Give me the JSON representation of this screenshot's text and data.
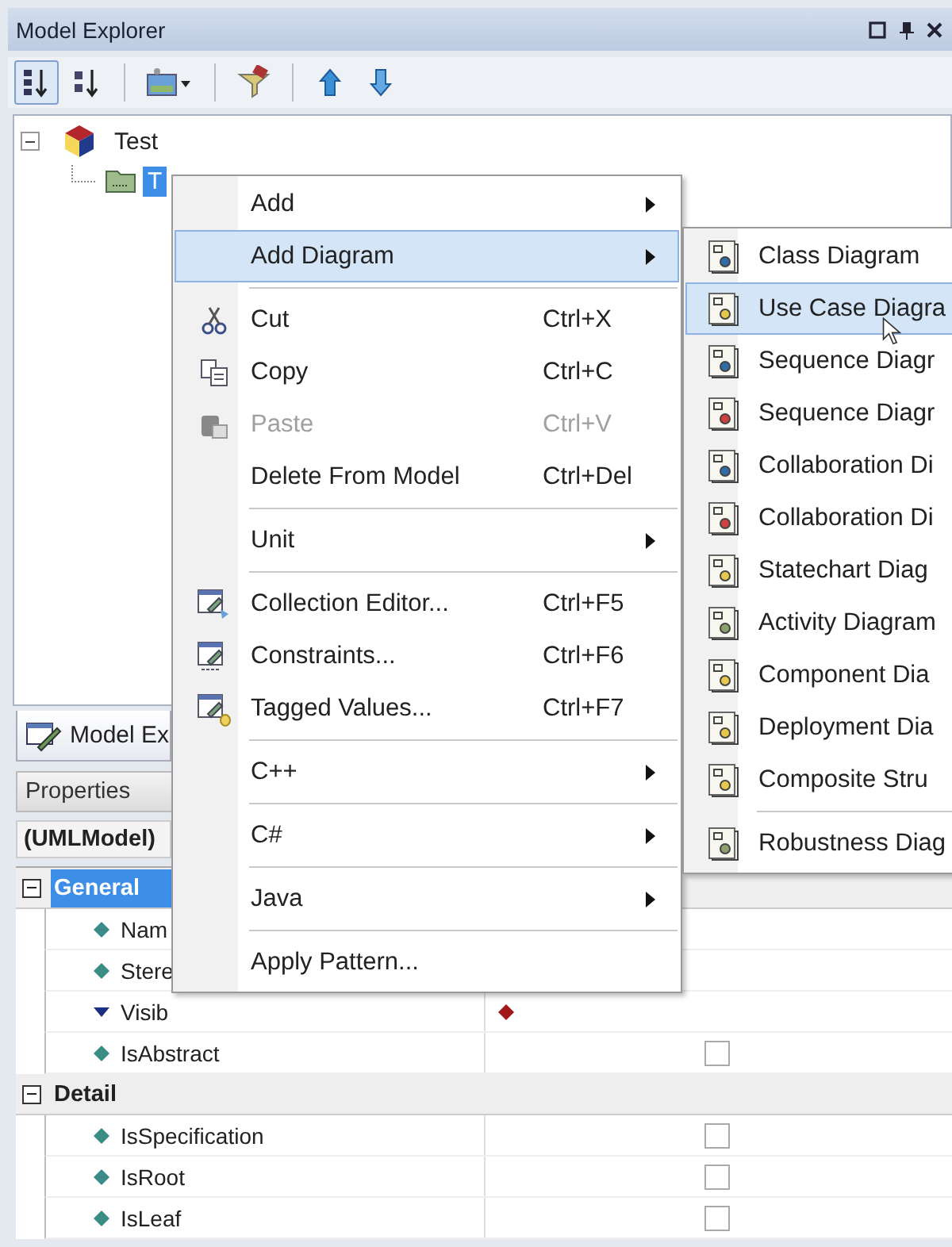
{
  "window": {
    "title": "Model Explorer"
  },
  "toolbar": [
    {
      "kind": "sort-numeric",
      "selected": true
    },
    {
      "kind": "sort-alpha",
      "selected": false
    },
    {
      "kind": "separator"
    },
    {
      "kind": "image-dropdown",
      "selected": false
    },
    {
      "kind": "separator"
    },
    {
      "kind": "filter",
      "selected": false
    },
    {
      "kind": "separator"
    },
    {
      "kind": "move-up",
      "selected": false
    },
    {
      "kind": "move-down",
      "selected": false
    }
  ],
  "tree": [
    {
      "label": "Test",
      "expanded": true,
      "selected": false,
      "children": [
        {
          "label": "T",
          "selected": true
        }
      ]
    }
  ],
  "tabs": [
    {
      "label": "Model Ex",
      "selected": true
    }
  ],
  "properties": {
    "title": "Properties",
    "object": "(UMLModel)",
    "categories": [
      {
        "name": "General",
        "expanded": true,
        "selected": true,
        "rows": [
          {
            "name": "Nam",
            "kind": "text"
          },
          {
            "name": "Stere",
            "kind": "text"
          },
          {
            "name": "Visib",
            "kind": "enum"
          },
          {
            "name": "IsAbstract",
            "kind": "bool",
            "checked": false
          }
        ]
      },
      {
        "name": "Detail",
        "expanded": true,
        "selected": false,
        "rows": [
          {
            "name": "IsSpecification",
            "kind": "bool",
            "checked": false
          },
          {
            "name": "IsRoot",
            "kind": "bool",
            "checked": false
          },
          {
            "name": "IsLeaf",
            "kind": "bool",
            "checked": false
          }
        ]
      }
    ]
  },
  "context_menu": {
    "items": [
      {
        "kind": "item",
        "label": "Add",
        "submenu": true,
        "selected": false,
        "disabled": false
      },
      {
        "kind": "item",
        "label": "Add Diagram",
        "submenu": true,
        "selected": true,
        "disabled": false
      },
      {
        "kind": "separator"
      },
      {
        "kind": "item",
        "label": "Cut",
        "shortcut": "Ctrl+X",
        "submenu": false,
        "selected": false,
        "disabled": false
      },
      {
        "kind": "item",
        "label": "Copy",
        "shortcut": "Ctrl+C",
        "submenu": false,
        "selected": false,
        "disabled": false
      },
      {
        "kind": "item",
        "label": "Paste",
        "shortcut": "Ctrl+V",
        "submenu": false,
        "selected": false,
        "disabled": true
      },
      {
        "kind": "item",
        "label": "Delete From Model",
        "shortcut": "Ctrl+Del",
        "submenu": false,
        "selected": false,
        "disabled": false
      },
      {
        "kind": "separator"
      },
      {
        "kind": "item",
        "label": "Unit",
        "submenu": true,
        "selected": false,
        "disabled": false
      },
      {
        "kind": "separator"
      },
      {
        "kind": "item",
        "label": "Collection Editor...",
        "shortcut": "Ctrl+F5",
        "submenu": false,
        "selected": false,
        "disabled": false
      },
      {
        "kind": "item",
        "label": "Constraints...",
        "shortcut": "Ctrl+F6",
        "submenu": false,
        "selected": false,
        "disabled": false
      },
      {
        "kind": "item",
        "label": "Tagged Values...",
        "shortcut": "Ctrl+F7",
        "submenu": false,
        "selected": false,
        "disabled": false
      },
      {
        "kind": "separator"
      },
      {
        "kind": "item",
        "label": "C++",
        "submenu": true,
        "selected": false,
        "disabled": false
      },
      {
        "kind": "separator"
      },
      {
        "kind": "item",
        "label": "C#",
        "submenu": true,
        "selected": false,
        "disabled": false
      },
      {
        "kind": "separator"
      },
      {
        "kind": "item",
        "label": "Java",
        "submenu": true,
        "selected": false,
        "disabled": false
      },
      {
        "kind": "separator"
      },
      {
        "kind": "item",
        "label": "Apply Pattern...",
        "submenu": false,
        "selected": false,
        "disabled": false
      }
    ]
  },
  "submenu": {
    "items": [
      {
        "kind": "item",
        "label": "Class Diagram",
        "selected": false
      },
      {
        "kind": "item",
        "label": "Use Case Diagra",
        "selected": true
      },
      {
        "kind": "item",
        "label": "Sequence Diagr",
        "selected": false
      },
      {
        "kind": "item",
        "label": "Sequence Diagr",
        "selected": false
      },
      {
        "kind": "item",
        "label": "Collaboration Di",
        "selected": false
      },
      {
        "kind": "item",
        "label": "Collaboration Di",
        "selected": false
      },
      {
        "kind": "item",
        "label": "Statechart Diag",
        "selected": false
      },
      {
        "kind": "item",
        "label": "Activity Diagram",
        "selected": false
      },
      {
        "kind": "item",
        "label": "Component Dia",
        "selected": false
      },
      {
        "kind": "item",
        "label": "Deployment Dia",
        "selected": false
      },
      {
        "kind": "item",
        "label": "Composite Stru",
        "selected": false
      },
      {
        "kind": "separator"
      },
      {
        "kind": "item",
        "label": "Robustness Diag",
        "selected": false
      }
    ]
  }
}
